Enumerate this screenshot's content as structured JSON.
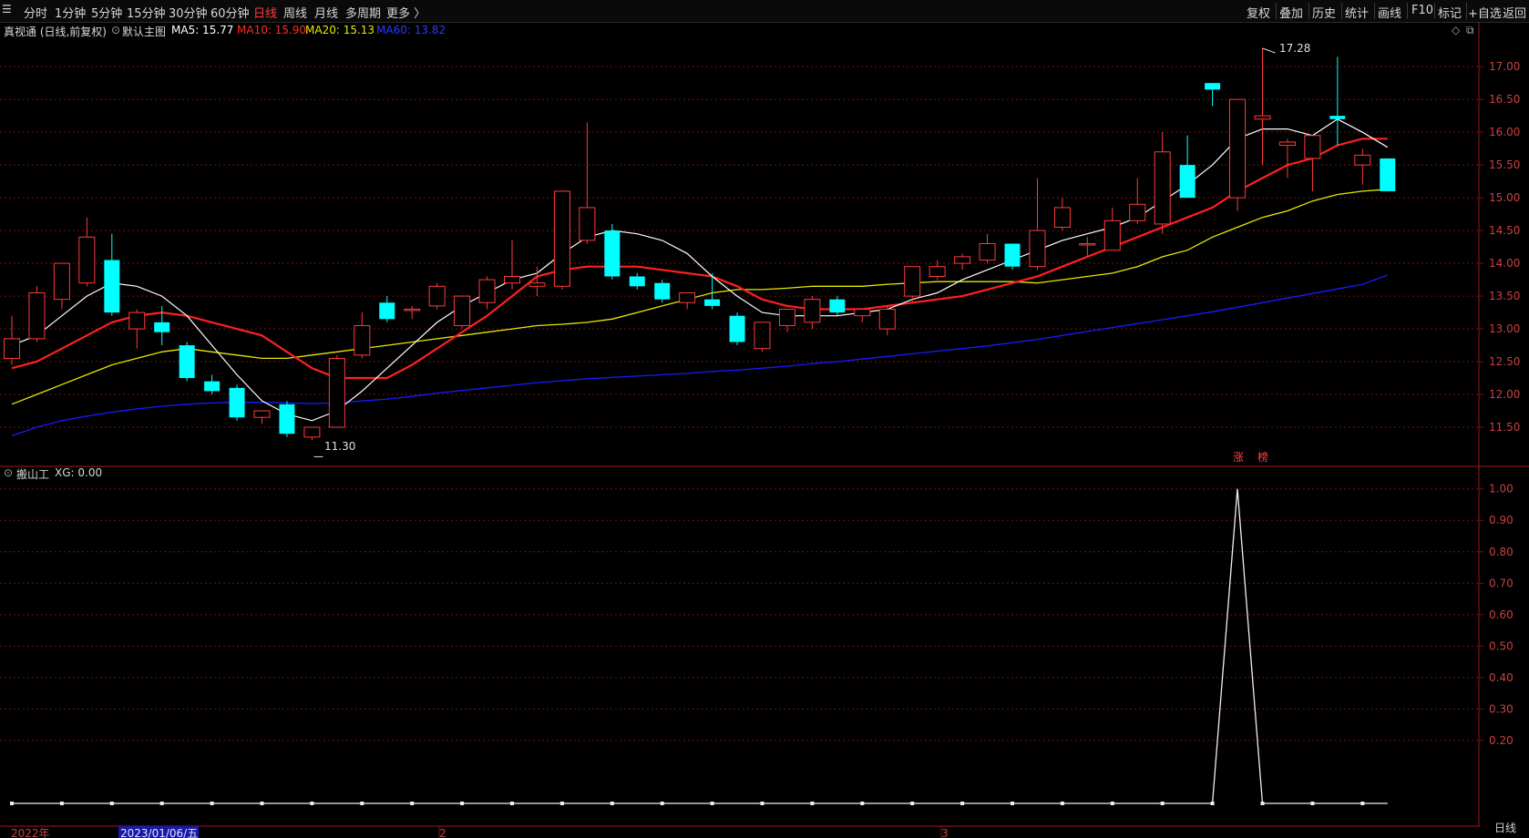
{
  "toolbar": {
    "left_items": [
      "分时",
      "1分钟",
      "5分钟",
      "15分钟",
      "30分钟",
      "60分钟",
      "日线",
      "周线",
      "月线",
      "多周期",
      "更多 〉"
    ],
    "active_index": 6,
    "right_items": [
      "复权",
      "叠加",
      "历史",
      "统计",
      "画线",
      "F10",
      "标记",
      "+自选",
      "返回"
    ]
  },
  "main_info": {
    "name": "真视通 (日线,前复权)",
    "template": "默认主图",
    "ma5_label": "MA5: 15.77",
    "ma10_label": "MA10: 15.90",
    "ma20_label": "MA20: 15.13",
    "ma60_label": "MA60: 13.82",
    "tool_icons": [
      "diamond-icon",
      "copy-icon"
    ]
  },
  "indicator_info": {
    "name": "搬山工",
    "value_label": "XG: 0.00"
  },
  "colors": {
    "up": "#ff3b3b",
    "down": "#00ffff",
    "ma5": "#ffffff",
    "ma10": "#ff2020",
    "ma20": "#e8e800",
    "ma60": "#1a1aff",
    "grid": "#7a1010",
    "axis_text": "#c84040"
  },
  "price_axis": {
    "ticks": [
      17.0,
      16.5,
      16.0,
      15.5,
      15.0,
      14.5,
      14.0,
      13.5,
      13.0,
      12.5,
      12.0,
      11.5
    ],
    "labels": [
      "17.00",
      "16.50",
      "16.00",
      "15.50",
      "15.00",
      "14.50",
      "14.00",
      "13.50",
      "13.00",
      "12.50",
      "12.00",
      "11.50"
    ]
  },
  "indicator_axis": {
    "ticks": [
      1.0,
      0.9,
      0.8,
      0.7,
      0.6,
      0.5,
      0.4,
      0.3,
      0.2
    ],
    "labels": [
      "1.00",
      "0.90",
      "0.80",
      "0.70",
      "0.60",
      "0.50",
      "0.40",
      "0.30",
      "0.20"
    ]
  },
  "annotations": {
    "high_label": "17.28",
    "low_label": "11.30",
    "zhang_label": "涨",
    "bang_label": "榜"
  },
  "date_axis": {
    "labels": [
      "2022年",
      "2023/01/06/五",
      "2",
      "3"
    ],
    "period_label": "日线"
  },
  "chart_data": {
    "type": "candlestick",
    "candles": [
      {
        "o": 12.55,
        "h": 13.2,
        "l": 12.45,
        "c": 12.85
      },
      {
        "o": 12.85,
        "h": 13.65,
        "l": 12.8,
        "c": 13.55
      },
      {
        "o": 13.45,
        "h": 14.0,
        "l": 13.3,
        "c": 14.0
      },
      {
        "o": 13.7,
        "h": 14.7,
        "l": 13.65,
        "c": 14.4
      },
      {
        "o": 14.05,
        "h": 14.45,
        "l": 13.2,
        "c": 13.25
      },
      {
        "o": 13.0,
        "h": 13.3,
        "l": 12.7,
        "c": 13.25
      },
      {
        "o": 13.1,
        "h": 13.35,
        "l": 12.75,
        "c": 12.95
      },
      {
        "o": 12.75,
        "h": 12.8,
        "l": 12.2,
        "c": 12.25
      },
      {
        "o": 12.2,
        "h": 12.3,
        "l": 12.0,
        "c": 12.05
      },
      {
        "o": 12.1,
        "h": 12.15,
        "l": 11.6,
        "c": 11.65
      },
      {
        "o": 11.65,
        "h": 11.75,
        "l": 11.55,
        "c": 11.75
      },
      {
        "o": 11.85,
        "h": 11.9,
        "l": 11.35,
        "c": 11.4
      },
      {
        "o": 11.35,
        "h": 11.5,
        "l": 11.3,
        "c": 11.5
      },
      {
        "o": 11.5,
        "h": 12.6,
        "l": 11.5,
        "c": 12.55
      },
      {
        "o": 12.6,
        "h": 13.25,
        "l": 12.55,
        "c": 13.05
      },
      {
        "o": 13.4,
        "h": 13.5,
        "l": 13.1,
        "c": 13.15
      },
      {
        "o": 13.3,
        "h": 13.35,
        "l": 13.15,
        "c": 13.3
      },
      {
        "o": 13.35,
        "h": 13.7,
        "l": 13.3,
        "c": 13.65
      },
      {
        "o": 13.05,
        "h": 13.5,
        "l": 13.0,
        "c": 13.5
      },
      {
        "o": 13.4,
        "h": 13.8,
        "l": 13.3,
        "c": 13.75
      },
      {
        "o": 13.7,
        "h": 14.35,
        "l": 13.6,
        "c": 13.8
      },
      {
        "o": 13.65,
        "h": 13.95,
        "l": 13.5,
        "c": 13.7
      },
      {
        "o": 13.65,
        "h": 15.1,
        "l": 13.6,
        "c": 15.1
      },
      {
        "o": 14.35,
        "h": 16.15,
        "l": 14.3,
        "c": 14.85
      },
      {
        "o": 14.5,
        "h": 14.6,
        "l": 13.75,
        "c": 13.8
      },
      {
        "o": 13.8,
        "h": 13.85,
        "l": 13.6,
        "c": 13.65
      },
      {
        "o": 13.7,
        "h": 13.75,
        "l": 13.4,
        "c": 13.45
      },
      {
        "o": 13.4,
        "h": 13.55,
        "l": 13.3,
        "c": 13.55
      },
      {
        "o": 13.45,
        "h": 13.85,
        "l": 13.3,
        "c": 13.35
      },
      {
        "o": 13.2,
        "h": 13.25,
        "l": 12.75,
        "c": 12.8
      },
      {
        "o": 12.7,
        "h": 13.1,
        "l": 12.65,
        "c": 13.1
      },
      {
        "o": 13.05,
        "h": 13.3,
        "l": 12.95,
        "c": 13.3
      },
      {
        "o": 13.1,
        "h": 13.5,
        "l": 13.0,
        "c": 13.45
      },
      {
        "o": 13.45,
        "h": 13.5,
        "l": 13.2,
        "c": 13.25
      },
      {
        "o": 13.2,
        "h": 13.3,
        "l": 13.1,
        "c": 13.3
      },
      {
        "o": 13.0,
        "h": 13.35,
        "l": 12.9,
        "c": 13.3
      },
      {
        "o": 13.5,
        "h": 13.95,
        "l": 13.4,
        "c": 13.95
      },
      {
        "o": 13.8,
        "h": 14.05,
        "l": 13.75,
        "c": 13.95
      },
      {
        "o": 14.0,
        "h": 14.15,
        "l": 13.9,
        "c": 14.1
      },
      {
        "o": 14.05,
        "h": 14.45,
        "l": 14.0,
        "c": 14.3
      },
      {
        "o": 14.3,
        "h": 14.3,
        "l": 13.9,
        "c": 13.95
      },
      {
        "o": 13.95,
        "h": 15.3,
        "l": 13.9,
        "c": 14.5
      },
      {
        "o": 14.55,
        "h": 15.0,
        "l": 14.5,
        "c": 14.85
      },
      {
        "o": 14.3,
        "h": 14.4,
        "l": 14.1,
        "c": 14.3
      },
      {
        "o": 14.2,
        "h": 14.85,
        "l": 14.2,
        "c": 14.65
      },
      {
        "o": 14.65,
        "h": 15.3,
        "l": 14.6,
        "c": 14.9
      },
      {
        "o": 14.6,
        "h": 16.0,
        "l": 14.45,
        "c": 15.7
      },
      {
        "o": 15.5,
        "h": 15.95,
        "l": 15.0,
        "c": 15.0
      },
      {
        "o": 16.75,
        "h": 16.75,
        "l": 16.4,
        "c": 16.65
      },
      {
        "o": 15.0,
        "h": 16.5,
        "l": 14.8,
        "c": 16.5
      },
      {
        "o": 16.2,
        "h": 17.28,
        "l": 15.5,
        "c": 16.25
      },
      {
        "o": 15.8,
        "h": 15.9,
        "l": 15.3,
        "c": 15.85
      },
      {
        "o": 15.6,
        "h": 15.95,
        "l": 15.1,
        "c": 15.95
      },
      {
        "o": 16.25,
        "h": 17.15,
        "l": 15.8,
        "c": 16.2
      },
      {
        "o": 15.5,
        "h": 15.75,
        "l": 15.2,
        "c": 15.65
      },
      {
        "o": 15.6,
        "h": 15.6,
        "l": 15.1,
        "c": 15.1
      }
    ],
    "ma5": [
      12.75,
      12.9,
      13.2,
      13.5,
      13.7,
      13.65,
      13.5,
      13.2,
      12.75,
      12.3,
      11.9,
      11.7,
      11.6,
      11.75,
      12.05,
      12.4,
      12.75,
      13.1,
      13.35,
      13.55,
      13.75,
      13.85,
      14.15,
      14.4,
      14.5,
      14.45,
      14.35,
      14.15,
      13.8,
      13.5,
      13.25,
      13.2,
      13.2,
      13.2,
      13.25,
      13.3,
      13.45,
      13.55,
      13.75,
      13.9,
      14.05,
      14.2,
      14.35,
      14.45,
      14.55,
      14.7,
      14.95,
      15.2,
      15.5,
      15.9,
      16.05,
      16.05,
      15.95,
      16.2,
      16.0,
      15.77
    ],
    "ma10": [
      12.4,
      12.5,
      12.7,
      12.9,
      13.1,
      13.2,
      13.25,
      13.2,
      13.1,
      13.0,
      12.9,
      12.65,
      12.4,
      12.25,
      12.25,
      12.25,
      12.45,
      12.7,
      12.95,
      13.2,
      13.5,
      13.8,
      13.9,
      13.95,
      13.95,
      13.95,
      13.9,
      13.85,
      13.8,
      13.65,
      13.45,
      13.35,
      13.3,
      13.3,
      13.3,
      13.35,
      13.4,
      13.45,
      13.5,
      13.6,
      13.7,
      13.8,
      13.95,
      14.1,
      14.25,
      14.4,
      14.55,
      14.7,
      14.85,
      15.1,
      15.3,
      15.5,
      15.6,
      15.8,
      15.9,
      15.9
    ],
    "ma20": [
      11.85,
      12.0,
      12.15,
      12.3,
      12.45,
      12.55,
      12.65,
      12.7,
      12.65,
      12.6,
      12.55,
      12.55,
      12.6,
      12.65,
      12.7,
      12.75,
      12.8,
      12.85,
      12.9,
      12.95,
      13.0,
      13.05,
      13.07,
      13.1,
      13.15,
      13.25,
      13.35,
      13.45,
      13.55,
      13.6,
      13.6,
      13.62,
      13.65,
      13.65,
      13.65,
      13.68,
      13.7,
      13.72,
      13.72,
      13.72,
      13.72,
      13.7,
      13.75,
      13.8,
      13.85,
      13.95,
      14.1,
      14.2,
      14.4,
      14.55,
      14.7,
      14.8,
      14.95,
      15.05,
      15.1,
      15.13
    ],
    "ma60": [
      11.37,
      11.5,
      11.6,
      11.67,
      11.73,
      11.78,
      11.82,
      11.85,
      11.87,
      11.88,
      11.88,
      11.87,
      11.86,
      11.87,
      11.9,
      11.93,
      11.97,
      12.02,
      12.06,
      12.1,
      12.14,
      12.18,
      12.21,
      12.24,
      12.26,
      12.28,
      12.3,
      12.32,
      12.35,
      12.37,
      12.4,
      12.43,
      12.47,
      12.5,
      12.54,
      12.58,
      12.62,
      12.66,
      12.7,
      12.74,
      12.79,
      12.84,
      12.9,
      12.96,
      13.02,
      13.08,
      13.14,
      13.2,
      13.26,
      13.33,
      13.4,
      13.47,
      13.54,
      13.61,
      13.68,
      13.82
    ],
    "xg": [
      0,
      0,
      0,
      0,
      0,
      0,
      0,
      0,
      0,
      0,
      0,
      0,
      0,
      0,
      0,
      0,
      0,
      0,
      0,
      0,
      0,
      0,
      0,
      0,
      0,
      0,
      0,
      0,
      0,
      0,
      0,
      0,
      0,
      0,
      0,
      0,
      0,
      0,
      0,
      0,
      0,
      0,
      0,
      0,
      0,
      0,
      0,
      0,
      0,
      1,
      0,
      0,
      0,
      0,
      0,
      0
    ],
    "price_range": [
      11.0,
      17.6
    ],
    "xg_range": [
      0,
      1.06
    ]
  }
}
